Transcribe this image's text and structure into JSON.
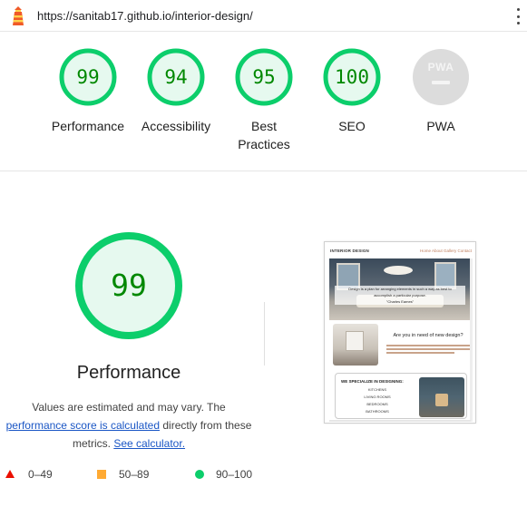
{
  "top_bar": {
    "url": "https://sanitab17.github.io/interior-design/"
  },
  "colors": {
    "pass": "#0cce6b",
    "pass_text": "#008800",
    "average": "#ffaa33",
    "fail": "#eb0f00",
    "link": "#1a56c5",
    "pwa_gray": "#dcdcdc"
  },
  "gauges": [
    {
      "label": "Performance",
      "score": 99
    },
    {
      "label": "Accessibility",
      "score": 94
    },
    {
      "label": "Best\nPractices",
      "score": 95
    },
    {
      "label": "SEO",
      "score": 100
    },
    {
      "label": "PWA",
      "badge": "PWA",
      "icon": "pwa-badge-icon"
    }
  ],
  "performance": {
    "score": 99,
    "title": "Performance",
    "desc_prefix": "Values are estimated and may vary. The",
    "link_score": "performance score is calculated",
    "desc_mid": "directly from these metrics.",
    "link_calculator": "See calculator."
  },
  "legend": [
    {
      "range": "0–49",
      "icon": "triangle-icon"
    },
    {
      "range": "50–89",
      "icon": "square-icon"
    },
    {
      "range": "90–100",
      "icon": "circle-icon"
    }
  ],
  "thumbnail": {
    "brand": "INTERIOR DESIGN",
    "nav": "Home  About  Gallery  Contact",
    "hero_caption_1": "Design is a plan for arranging elements in such a way as best to",
    "hero_caption_2": "accomplish a particular purpose.",
    "hero_caption_3": "\"Charles Eames\"",
    "need_heading": "Are you in need of new design?",
    "specialize_heading": "WE SPECIALIZE IN DESIGNING:",
    "specialize_items": [
      "KITCHENS",
      "LIVING ROOMS",
      "BEDROOMS",
      "BATHROOMS"
    ]
  }
}
